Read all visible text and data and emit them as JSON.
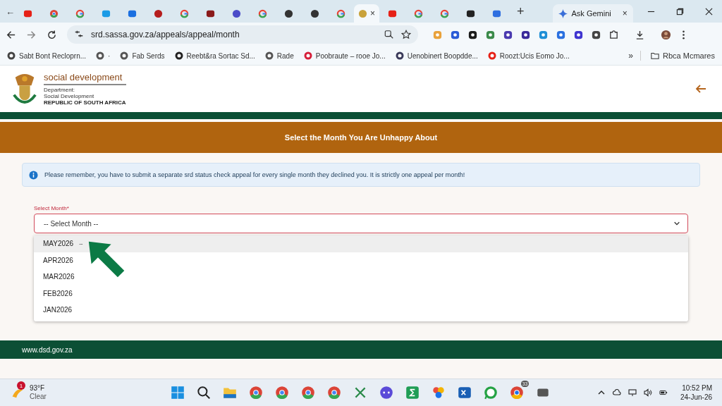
{
  "browser": {
    "tab_search": "←",
    "tabs": [
      {
        "kind": "square",
        "color": "#e62117",
        "selected": false
      },
      {
        "kind": "chrome",
        "selected": false
      },
      {
        "kind": "google",
        "selected": false
      },
      {
        "kind": "square",
        "color": "#1a9be6",
        "selected": false
      },
      {
        "kind": "square",
        "color": "#1a6fe0",
        "selected": false
      },
      {
        "kind": "circle",
        "color": "#b51d1d",
        "selected": false
      },
      {
        "kind": "google",
        "selected": false
      },
      {
        "kind": "square",
        "color": "#8a1a1a",
        "selected": false
      },
      {
        "kind": "circle",
        "color": "#4a4bc8",
        "selected": false
      },
      {
        "kind": "google",
        "selected": false
      },
      {
        "kind": "circle",
        "color": "#333333",
        "selected": false
      },
      {
        "kind": "circle",
        "color": "#333333",
        "selected": false
      },
      {
        "kind": "google",
        "selected": false
      },
      {
        "kind": "circle",
        "color": "#c9a23a",
        "selected": true,
        "close": "×"
      },
      {
        "kind": "square",
        "color": "#e62117",
        "selected": false
      },
      {
        "kind": "google",
        "selected": false
      },
      {
        "kind": "google",
        "selected": false
      },
      {
        "kind": "square",
        "color": "#222222",
        "selected": false
      },
      {
        "kind": "square",
        "color": "#2f6fe0",
        "selected": false
      }
    ],
    "new_tab": "+",
    "side_tab": {
      "label": "Ask Gemini",
      "close": "×"
    },
    "url": "srd.sassa.gov.za/appeals/appeal/month",
    "bookmarks": [
      {
        "label": "Sabt Bont Recloprn...",
        "color": "#444444"
      },
      {
        "label": "·",
        "color": "#555555"
      },
      {
        "label": "Fab Serds",
        "color": "#555555"
      },
      {
        "label": "Reebt&ra Sortac Sd...",
        "color": "#222222"
      },
      {
        "label": "Rade",
        "color": "#555555"
      },
      {
        "label": "Poobraute – rooe Jo...",
        "color": "#d61f3a"
      },
      {
        "label": "Uenobinert Boopdde...",
        "color": "#3a3a5a"
      },
      {
        "label": "Roozt:Ucis Eomo Jo...",
        "color": "#e62117"
      }
    ],
    "more": "»",
    "folder": "Rbca Mcmares"
  },
  "header": {
    "department_name": "social development",
    "sub_lines": [
      "Department:",
      "Social Development"
    ],
    "country": "REPUBLIC OF SOUTH AFRICA"
  },
  "banner": {
    "title": "Select the Month You Are Unhappy About"
  },
  "notice": {
    "text": "Please remember, you have to submit a separate srd status check appeal for every single month they declined you. It is strictly one appeal per month!"
  },
  "month_select": {
    "label": "Select Month*",
    "value": "-- Select Month --",
    "expanded": true,
    "options": [
      {
        "label": "MAY2026",
        "marker": "--",
        "selected": true
      },
      {
        "label": "APR2026",
        "selected": false
      },
      {
        "label": "MAR2026",
        "selected": false
      },
      {
        "label": "FEB2026",
        "selected": false
      },
      {
        "label": "JAN2026",
        "selected": false
      }
    ]
  },
  "footer": {
    "link": "www.dsd.gov.za"
  },
  "taskbar": {
    "weather": {
      "badge": "1",
      "temperature": "93°F",
      "condition": "Clear"
    },
    "chrome_badge": "33",
    "time": "10:52 PM",
    "date": "24-Jun-26"
  }
}
